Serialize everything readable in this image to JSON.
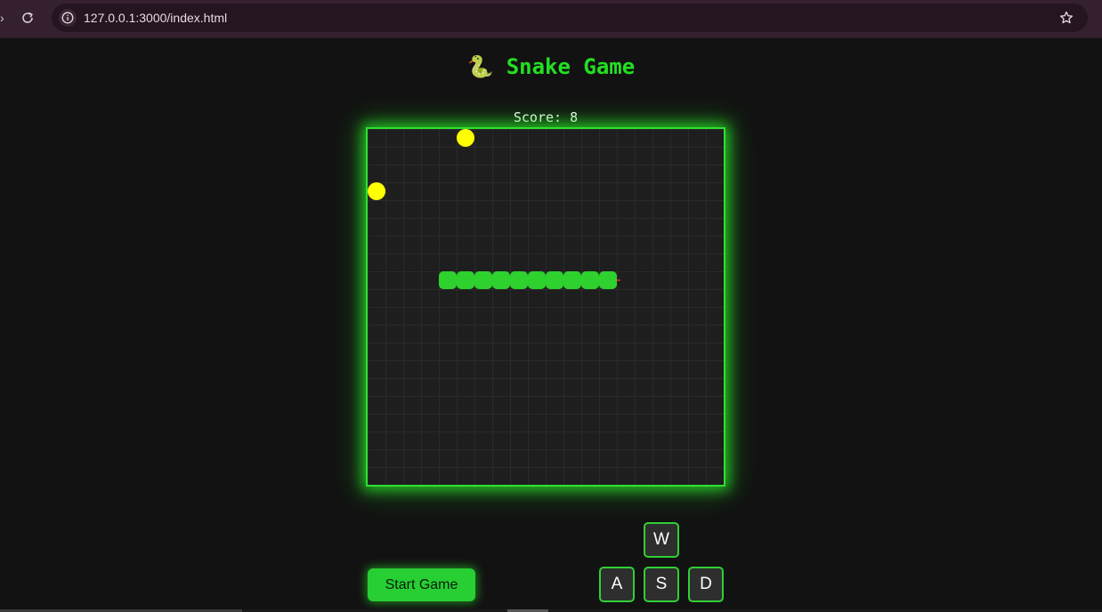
{
  "browser": {
    "url": "127.0.0.1:3000/index.html"
  },
  "game": {
    "title_emoji": "🐍",
    "title": "Snake Game",
    "score_label": "Score:",
    "score": 8,
    "start_button": "Start Game",
    "keys": {
      "up": "W",
      "left": "A",
      "down": "S",
      "right": "D"
    },
    "grid": {
      "columns": 20,
      "rows": 20
    },
    "snake": [
      {
        "col": 13,
        "row": 8
      },
      {
        "col": 12,
        "row": 8
      },
      {
        "col": 11,
        "row": 8
      },
      {
        "col": 10,
        "row": 8
      },
      {
        "col": 9,
        "row": 8
      },
      {
        "col": 8,
        "row": 8
      },
      {
        "col": 7,
        "row": 8
      },
      {
        "col": 6,
        "row": 8
      },
      {
        "col": 5,
        "row": 8
      },
      {
        "col": 4,
        "row": 8
      }
    ],
    "snake_direction": "right",
    "food": [
      {
        "col": 5,
        "row": 0
      },
      {
        "col": 0,
        "row": 3
      }
    ],
    "colors": {
      "snake": "#2ed12e",
      "food": "#ffff00",
      "tongue": "#ff2020",
      "accent": "#22e022"
    }
  }
}
